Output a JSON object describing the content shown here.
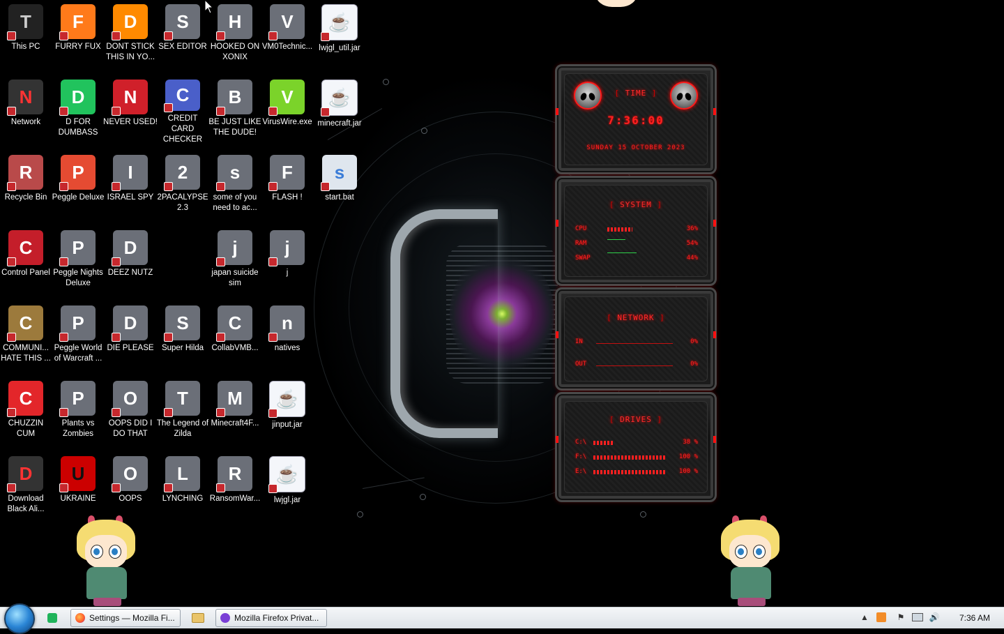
{
  "desktop": {
    "icons": [
      {
        "label": "This PC",
        "icon": "computer-icon"
      },
      {
        "label": "FURRY FUX",
        "icon": "firefox-icon"
      },
      {
        "label": "DONT STICK THIS IN YO...",
        "icon": "vlc-cone-icon"
      },
      {
        "label": "SEX EDITOR",
        "icon": "hxd-hex-editor-icon"
      },
      {
        "label": "HOOKED ON XONIX",
        "icon": "xonix-game-icon"
      },
      {
        "label": "VM0Technic...",
        "icon": "doctor-icon"
      },
      {
        "label": "lwjgl_util.jar",
        "icon": "java-jar-icon"
      },
      {
        "label": "Network",
        "icon": "network-icon"
      },
      {
        "label": "D FOR DUMBASS",
        "icon": "chat-app-icon"
      },
      {
        "label": "NEVER USED!",
        "icon": "dev-cpp-icon"
      },
      {
        "label": "CREDIT CARD CHECKER",
        "icon": "credit-card-icon"
      },
      {
        "label": "BE JUST LIKE THE DUDE!",
        "icon": "santa-game-icon"
      },
      {
        "label": "VirusWire.exe",
        "icon": "limewire-icon"
      },
      {
        "label": "minecraft.jar",
        "icon": "java-jar-icon"
      },
      {
        "label": "Recycle Bin",
        "icon": "recycle-bin-icon"
      },
      {
        "label": "Peggle Deluxe",
        "icon": "peggle-icon"
      },
      {
        "label": "ISRAEL SPY",
        "icon": "spy-app-icon"
      },
      {
        "label": "2PACALYPSE 2.3",
        "icon": "console-app-icon"
      },
      {
        "label": "some of you need to ac...",
        "icon": "beaver-icon"
      },
      {
        "label": "FLASH !",
        "icon": "flash-file-icon"
      },
      {
        "label": "start.bat",
        "icon": "batch-file-icon"
      },
      {
        "label": "Control Panel",
        "icon": "control-panel-icon"
      },
      {
        "label": "Peggle Nights Deluxe",
        "icon": "peggle-nights-icon"
      },
      {
        "label": "DEEZ NUTZ",
        "icon": "stacked-windows-icon"
      },
      {
        "label": "japan suicide sim",
        "icon": "game-file-icon"
      },
      {
        "label": "j",
        "icon": "flash-file-icon"
      },
      {
        "label": "COMMUNI... HATE THIS ...",
        "icon": "money-bag-icon"
      },
      {
        "label": "Peggle World of Warcraft ...",
        "icon": "peggle-wow-icon"
      },
      {
        "label": "DIE PLEASE",
        "icon": "de-app-icon"
      },
      {
        "label": "Super Hilda",
        "icon": "pixel-cat-icon"
      },
      {
        "label": "CollabVMB...",
        "icon": "collabvm-icon"
      },
      {
        "label": "natives",
        "icon": "flash-file-icon"
      },
      {
        "label": "CHUZZIN CUM",
        "icon": "chuzzle-icon"
      },
      {
        "label": "Plants vs Zombies",
        "icon": "plants-vs-zombies-icon"
      },
      {
        "label": "OOPS DID I DO THAT",
        "icon": "portrait-icon"
      },
      {
        "label": "The Legend of Zilda",
        "icon": "pixel-hero-icon"
      },
      {
        "label": "Minecraft4F...",
        "icon": "minecraft-block-icon"
      },
      {
        "label": "jinput.jar",
        "icon": "java-jar-icon"
      },
      {
        "label": "Download Black Ali...",
        "icon": "alien-icon"
      },
      {
        "label": "UKRAINE",
        "icon": "radiation-icon"
      },
      {
        "label": "OOPS",
        "icon": "portrait-64-icon"
      },
      {
        "label": "LYNCHING",
        "icon": "cube-app-icon"
      },
      {
        "label": "RansomWar...",
        "icon": "skull-icon"
      },
      {
        "label": "lwjgl.jar",
        "icon": "java-jar-icon"
      }
    ]
  },
  "widgets": {
    "time": {
      "title": "TIME",
      "clock": "7:36:00",
      "date": "SUNDAY 15 OCTOBER 2023"
    },
    "system": {
      "title": "SYSTEM",
      "rows": [
        {
          "key": "CPU",
          "value": "36%",
          "fraction": 0.36
        },
        {
          "key": "RAM",
          "value": "54%",
          "fraction": 0.54
        },
        {
          "key": "SWAP",
          "value": "44%",
          "fraction": 0.44
        }
      ]
    },
    "network": {
      "title": "NETWORK",
      "rows": [
        {
          "key": "IN",
          "value": "0%"
        },
        {
          "key": "OUT",
          "value": "0%"
        }
      ]
    },
    "drives": {
      "title": "DRIVES",
      "rows": [
        {
          "key": "C:\\",
          "value": "38 %",
          "fraction": 0.38
        },
        {
          "key": "F:\\",
          "value": "100 %",
          "fraction": 1.0
        },
        {
          "key": "E:\\",
          "value": "100 %",
          "fraction": 1.0
        }
      ]
    }
  },
  "taskbar": {
    "windows": [
      {
        "label": "Settings — Mozilla Fi...",
        "icon": "firefox-icon"
      },
      {
        "label": "Mozilla Firefox Privat...",
        "icon": "private-browsing-icon"
      }
    ],
    "clock": "7:36 AM"
  },
  "colors": {
    "widget_red": "#ff2020",
    "taskbar": "#e6eaee",
    "desktop": "#000000"
  }
}
